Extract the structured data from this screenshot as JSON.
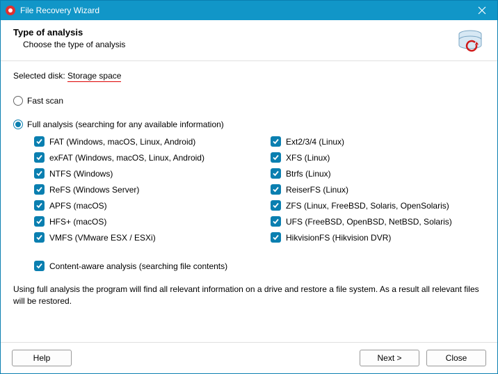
{
  "titlebar": {
    "title": "File Recovery Wizard"
  },
  "header": {
    "title": "Type of analysis",
    "subtitle": "Choose the type of analysis"
  },
  "selected_disk": {
    "label": "Selected disk: ",
    "name": "Storage space"
  },
  "scan_modes": {
    "fast": "Fast scan",
    "full": "Full analysis (searching for any available information)"
  },
  "filesystems": {
    "left": [
      "FAT (Windows, macOS, Linux, Android)",
      "exFAT (Windows, macOS, Linux, Android)",
      "NTFS (Windows)",
      "ReFS (Windows Server)",
      "APFS (macOS)",
      "HFS+ (macOS)",
      "VMFS (VMware ESX / ESXi)"
    ],
    "right": [
      "Ext2/3/4 (Linux)",
      "XFS (Linux)",
      "Btrfs (Linux)",
      "ReiserFS (Linux)",
      "ZFS (Linux, FreeBSD, Solaris, OpenSolaris)",
      "UFS (FreeBSD, OpenBSD, NetBSD, Solaris)",
      "HikvisionFS (Hikvision DVR)"
    ]
  },
  "content_aware": "Content-aware analysis (searching file contents)",
  "description": "Using full analysis the program will find all relevant information on a drive and restore a file system. As a result all relevant files will be restored.",
  "buttons": {
    "help": "Help",
    "next": "Next >",
    "close": "Close"
  }
}
